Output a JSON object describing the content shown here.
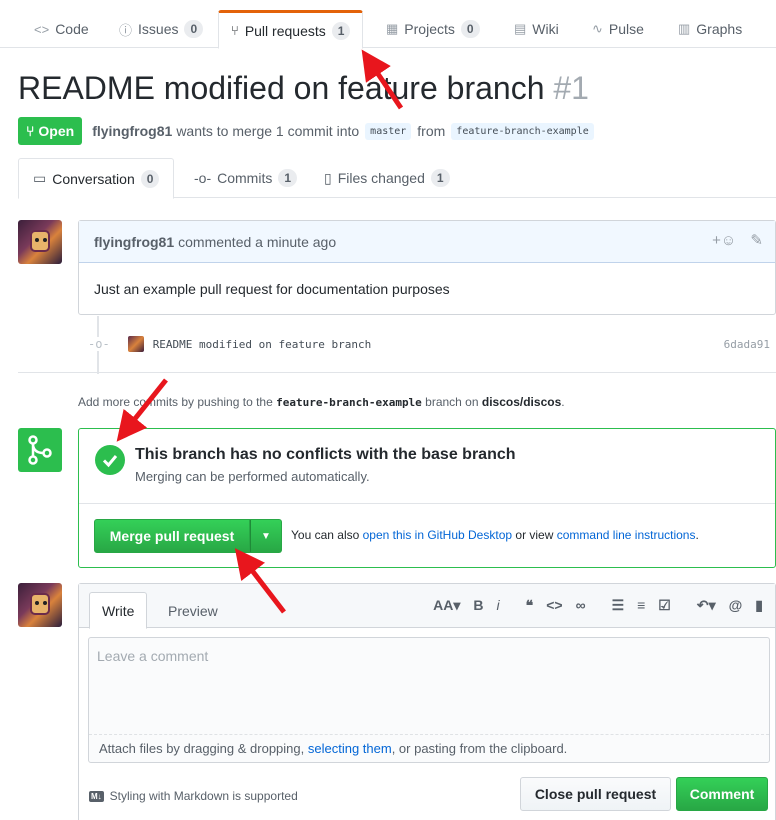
{
  "reponav": {
    "code": "Code",
    "issues": "Issues",
    "issues_count": "0",
    "pulls": "Pull requests",
    "pulls_count": "1",
    "projects": "Projects",
    "projects_count": "0",
    "wiki": "Wiki",
    "pulse": "Pulse",
    "graphs": "Graphs"
  },
  "pr": {
    "title": "README modified on feature branch",
    "number": "#1",
    "state": "Open",
    "author": "flyingfrog81",
    "merge_text_1": "wants to merge 1 commit into",
    "base": "master",
    "merge_text_2": "from",
    "head": "feature-branch-example"
  },
  "tabs": {
    "conversation": "Conversation",
    "conversation_count": "0",
    "commits": "Commits",
    "commits_count": "1",
    "files": "Files changed",
    "files_count": "1"
  },
  "comment": {
    "author": "flyingfrog81",
    "time": "commented a minute ago",
    "body": "Just an example pull request for documentation purposes",
    "reaction": "+☺",
    "edit": "✎"
  },
  "commit": {
    "message": "README modified on feature branch",
    "sha": "6dada91"
  },
  "info": {
    "text_1": "Add more commits by pushing to the",
    "branch": "feature-branch-example",
    "text_2": "branch on",
    "repo": "discos/discos",
    "text_3": "."
  },
  "merge": {
    "title": "This branch has no conflicts with the base branch",
    "subtitle": "Merging can be performed automatically.",
    "button": "Merge pull request",
    "alt_1": "You can also",
    "alt_link_1": "open this in GitHub Desktop",
    "alt_2": "or view",
    "alt_link_2": "command line instructions",
    "alt_3": "."
  },
  "form": {
    "write_tab": "Write",
    "preview_tab": "Preview",
    "placeholder": "Leave a comment",
    "drop_1": "Attach files by dragging & dropping,",
    "drop_link": "selecting them",
    "drop_2": ", or pasting from the clipboard.",
    "markdown": "Styling with Markdown is supported",
    "markdown_icon": "M↓",
    "close_button": "Close pull request",
    "comment_button": "Comment"
  },
  "colors": {
    "accent_orange": "#e36209",
    "open_green": "#2cbe4e",
    "link_blue": "#0366d6",
    "annotation_red": "#e8161d"
  }
}
